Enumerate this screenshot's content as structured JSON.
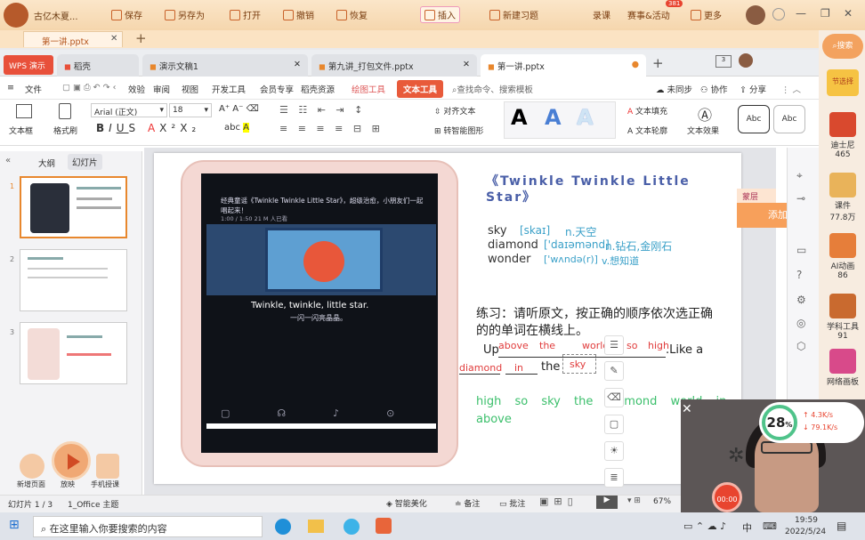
{
  "app": {
    "title": "古亿木夏...",
    "menu": [
      "保存",
      "另存为",
      "打开",
      "撤销",
      "恢复"
    ],
    "insert": "插入",
    "newtask": "新建习题",
    "record": "录课",
    "events": "赛事&活动",
    "events_badge": "381",
    "more": "更多",
    "doc_tab": "第一讲.pptx",
    "add_tab": "+"
  },
  "wps": {
    "logo": "WPS 演示",
    "tabs": [
      "稻壳",
      "演示文稿1",
      "第九讲_打包文件.pptx",
      "第一讲.pptx"
    ],
    "add": "+",
    "menu": [
      "文件",
      "审阅",
      "视图",
      "开发工具",
      "会员专享",
      "稻壳资源",
      "绘图工具",
      "文本工具"
    ],
    "menu_first_partial": "效验",
    "search": "查找命令、搜索模板",
    "unsync": "未同步",
    "collab": "协作",
    "share": "分享"
  },
  "ribbon": {
    "textbox": "文本框",
    "format_brush": "格式刷",
    "font": "Arial (正文)",
    "size": "18",
    "align_text": "对齐文本",
    "smartart": "转智能图形",
    "text_fill": "文本填充",
    "text_outline": "文本轮廓",
    "text_effect": "文本效果",
    "style_label": "Abc"
  },
  "panel": {
    "outline": "大纲",
    "slides": "幻灯片",
    "numbers": [
      "1",
      "2",
      "3"
    ]
  },
  "slide": {
    "title": "《Twinkle Twinkle Little Star》",
    "screen_top": "经典童谣《Twinkle Twinkle Little Star》，超级治愈，小朋友们一起唱起来！",
    "screen_top2": "1:00 / 1:50      21 M 人已看",
    "screen_lyric": "Twinkle, twinkle, little star.",
    "screen_lyric_cn": "一闪一闪亮晶晶。",
    "vocab": [
      {
        "word": "sky",
        "ipa": "[skaɪ]",
        "meaning": "n.天空"
      },
      {
        "word": "diamond",
        "ipa": "['daɪəmənd]",
        "meaning": "n.钻石,金刚石"
      },
      {
        "word": "wonder",
        "ipa": "['wʌndə(r)]",
        "meaning": "v.想知道"
      }
    ],
    "exercise": "练习：请听原文，按正确的顺序依次选正确的的单词在横线上。",
    "line1_start": "Up",
    "line1_end": ".Like a",
    "line2_the": "the",
    "answers": [
      "above",
      "the",
      "world",
      "so",
      "high",
      "diamond",
      "in",
      "sky"
    ],
    "options_line1": "high  so  sky  the  diamond  world  in",
    "options_line2": "above"
  },
  "side_tools": {
    "layer": "蒙层",
    "add": "添加"
  },
  "status": {
    "slide": "幻灯片 1 / 3",
    "theme": "1_Office 主题",
    "beautify": "智能美化",
    "notes": "备注",
    "comments": "批注",
    "zoom": "67%"
  },
  "bottom_tools": [
    "新增页面",
    "放映",
    "手机授课"
  ],
  "right_sidebar": {
    "search": "搜索",
    "items": [
      {
        "label": "迪士尼",
        "count": "465"
      },
      {
        "label": "课件",
        "count": "77.8万"
      },
      {
        "label": "AI动画",
        "count": "86"
      },
      {
        "label": "学科工具",
        "count": "91"
      },
      {
        "label": "网络画板",
        "count": ""
      }
    ],
    "festival": "节选择"
  },
  "webcam": {
    "net_pct": "28",
    "pct_sign": "%",
    "up": "4.3K/s",
    "down": "79.1K/s",
    "timer": "00:00"
  },
  "taskbar": {
    "search": "在这里输入你要搜索的内容",
    "time": "19:59",
    "date": "2022/5/24",
    "ime": "中"
  }
}
